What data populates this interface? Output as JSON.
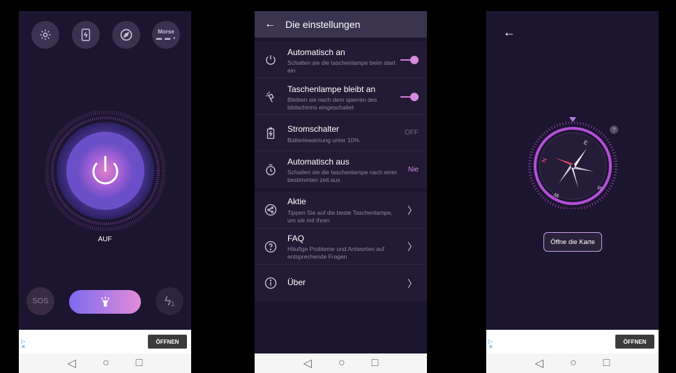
{
  "screen1": {
    "top_icons": [
      {
        "name": "settings",
        "icon": "gear-icon"
      },
      {
        "name": "screen-light",
        "icon": "phone-light-icon"
      },
      {
        "name": "compass",
        "icon": "compass-icon"
      },
      {
        "name": "morse",
        "label": "Morse"
      }
    ],
    "state_label": "AUF",
    "sos_label": "SOS",
    "bolt_sub": "1",
    "ad": {
      "open_label": "ÖFFNEN"
    }
  },
  "screen2": {
    "title": "Die einstellungen",
    "items": [
      {
        "title": "Automatisch an",
        "subtitle": "Schalten sie die taschenlampe beim start ein",
        "control": "toggle-on"
      },
      {
        "title": "Taschenlampe bleibt an",
        "subtitle": "Bleiben sie nach dem sperren des bildschirms eingeschaltet",
        "control": "toggle-on"
      },
      {
        "title": "Stromschalter",
        "subtitle": "Batteriewarnung unter 10%",
        "value": "OFF"
      },
      {
        "title": "Automatisch aus",
        "subtitle": "Schalten sie die taschenlampe nach einer bestimmten zeit aus",
        "value": "Nie"
      },
      {
        "title": "Aktie",
        "subtitle": "Tippen Sie auf die beste Taschenlampe, um sie mit Ihren"
      },
      {
        "title": "FAQ",
        "subtitle": "Häufige Probleme und Antworten auf entsprechende Fragen"
      },
      {
        "title": "Über"
      }
    ],
    "colors": {
      "accent": "#d68ae0",
      "value_off": "#6d6682",
      "value_nie": "#d68ae0"
    }
  },
  "screen3": {
    "open_map_label": "Öffne die Karte",
    "help_label": "?",
    "ad": {
      "open_label": "ÖFFNEN"
    }
  }
}
